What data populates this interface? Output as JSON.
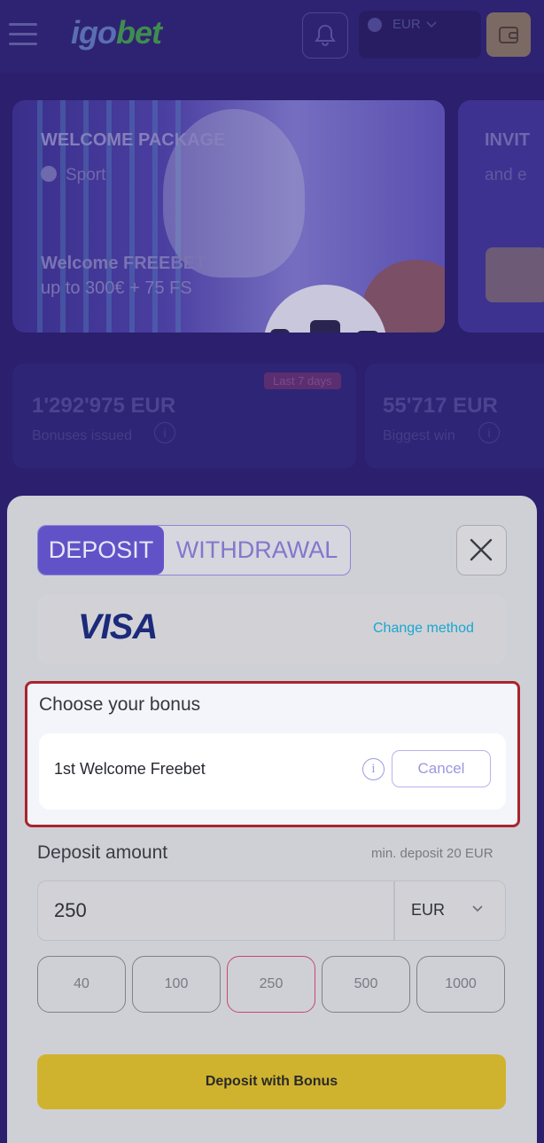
{
  "header": {
    "logo_part1": "igo",
    "logo_part2": "bet",
    "currency": "EUR"
  },
  "banner": {
    "title": "WELCOME PACKAGE",
    "category": "Sport",
    "offer_line1": "Welcome FREEBET",
    "offer_line2": "up to 300€ + 75 FS"
  },
  "banner2": {
    "title": "INVIT",
    "subtitle": "and e"
  },
  "stats": [
    {
      "value": "1'292'975 EUR",
      "label": "Bonuses issued",
      "badge": "Last 7 days"
    },
    {
      "value": "55'717 EUR",
      "label": "Biggest win"
    }
  ],
  "modal": {
    "tabs": {
      "deposit": "DEPOSIT",
      "withdrawal": "WITHDRAWAL"
    },
    "method": {
      "logo_text": "VISA",
      "change_label": "Change method"
    },
    "bonus": {
      "title": "Choose your bonus",
      "selected": "1st Welcome Freebet",
      "info_glyph": "i",
      "cancel_label": "Cancel"
    },
    "amount": {
      "label": "Deposit amount",
      "min_note": "min. deposit 20 EUR",
      "value": "250",
      "currency": "EUR"
    },
    "quick_amounts": [
      "40",
      "100",
      "250",
      "500",
      "1000"
    ],
    "selected_quick_amount": "250",
    "submit_label": "Deposit with Bonus"
  },
  "colors": {
    "accent": "#6153c7",
    "highlight_border": "#a8252e",
    "submit": "#cfb32e",
    "link": "#1aa6d0"
  },
  "icons": [
    "menu-icon",
    "bell-icon",
    "globe-icon",
    "chevron-down-icon",
    "wallet-icon",
    "close-icon",
    "info-icon"
  ]
}
